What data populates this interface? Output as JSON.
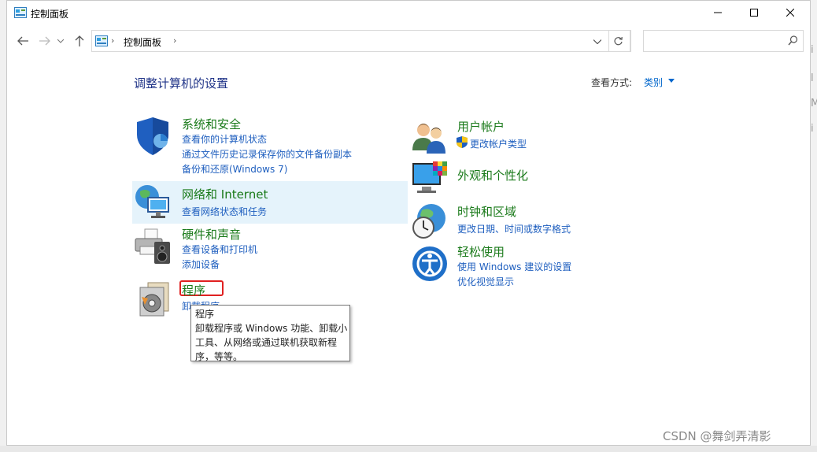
{
  "window": {
    "title": "控制面板",
    "controls": {
      "minimize": "minimize",
      "maximize": "maximize",
      "close": "close"
    }
  },
  "nav": {
    "breadcrumb": "控制面板",
    "separator": "›",
    "search_placeholder": ""
  },
  "main": {
    "title": "调整计算机的设置",
    "view_by_label": "查看方式:",
    "view_by_value": "类别"
  },
  "categories": [
    {
      "title": "系统和安全",
      "links": [
        "查看你的计算机状态",
        "通过文件历史记录保存你的文件备份副本",
        "备份和还原(Windows 7)"
      ]
    },
    {
      "title": "网络和 Internet",
      "links": [
        "查看网络状态和任务"
      ]
    },
    {
      "title": "硬件和声音",
      "links": [
        "查看设备和打印机",
        "添加设备"
      ]
    },
    {
      "title": "程序",
      "links": [
        "卸载程序"
      ]
    },
    {
      "title": "用户帐户",
      "links": [
        "更改帐户类型"
      ]
    },
    {
      "title": "外观和个性化",
      "links": []
    },
    {
      "title": "时钟和区域",
      "links": [
        "更改日期、时间或数字格式"
      ]
    },
    {
      "title": "轻松使用",
      "links": [
        "使用 Windows 建议的设置",
        "优化视觉显示"
      ]
    }
  ],
  "tooltip": {
    "title": "程序",
    "body": "卸载程序或 Windows 功能、卸载小工具、从网络或通过联机获取新程序，等等。"
  },
  "watermark": "CSDN @舞剑弄清影",
  "colors": {
    "category_title": "#1a7a1a",
    "link": "#1f5fbf",
    "page_title": "#1e3287",
    "hover_row": "#e5f3fb",
    "focus_box": "#e02020"
  }
}
